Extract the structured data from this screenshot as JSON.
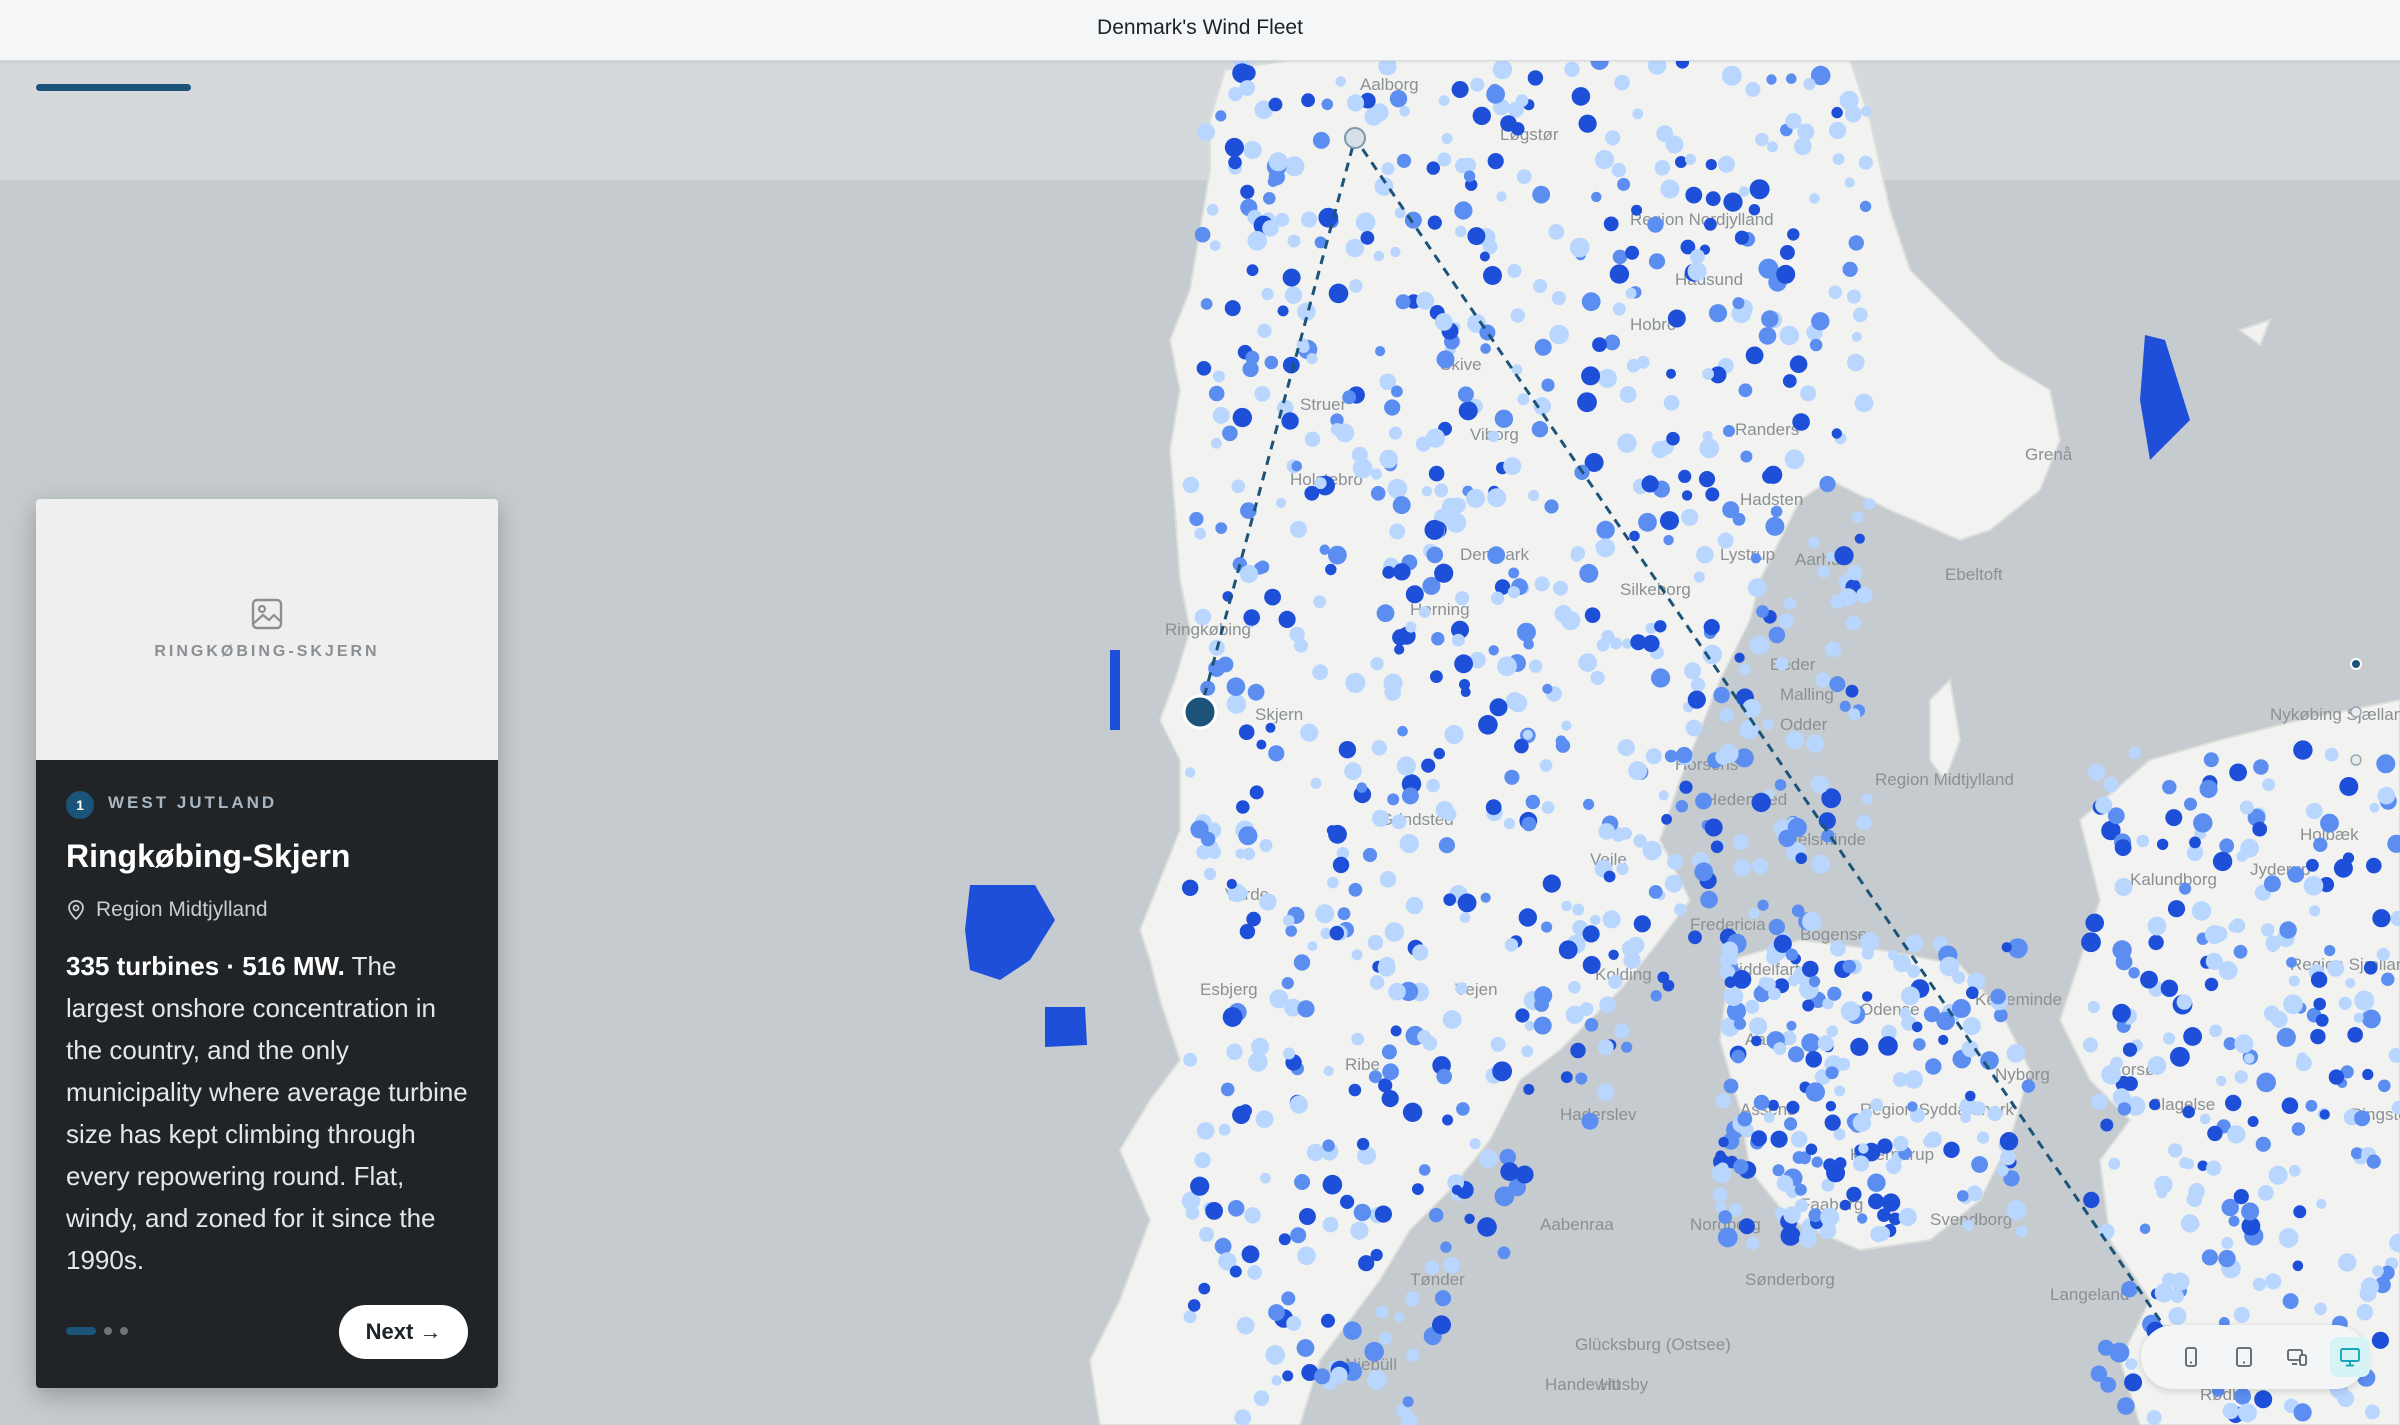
{
  "header": {
    "title": "Denmark's Wind Fleet"
  },
  "colors": {
    "accent": "#1b5478",
    "turbine_large": "#1e4fd8",
    "turbine_medium": "#5b8ef0",
    "turbine_small": "#b9d6ff",
    "land": "#f2f3f1",
    "water": "#c5cbce",
    "card_dark": "#202427",
    "route_line": "#1b5478"
  },
  "map": {
    "place_labels": [
      "Aalborg",
      "Løgstør",
      "Region Nordjylland",
      "Hobro",
      "Hadsund",
      "Randers",
      "Grenå",
      "Struer",
      "Holstebro",
      "Viborg",
      "Hadsten",
      "Lystrup",
      "Ebeltoft",
      "Skive",
      "Denmark",
      "Silkeborg",
      "Aarhus",
      "Herning",
      "Ringkøbing",
      "Skjern",
      "Beder",
      "Malling",
      "Odder",
      "Horsens",
      "Hedensted",
      "Juelsminde",
      "Region Midtjylland",
      "Grindsted",
      "Vejle",
      "Varde",
      "Fredericia",
      "Bogense",
      "Kerteminde",
      "Esbjerg",
      "Kolding",
      "Middelfart",
      "Odense",
      "Nyborg",
      "Korsør",
      "Ribe",
      "Vejen",
      "Aarup",
      "Assens",
      "Region Syddanmark",
      "Haderslev",
      "Kværndrup",
      "Faaborg",
      "Svendborg",
      "Nykøbing Sjælland",
      "Holbæk",
      "Kalundborg",
      "Jyderup",
      "Region Sjælland",
      "Slagelse",
      "Ringsted",
      "Aabenraa",
      "Nordborg",
      "Sønderborg",
      "Tønder",
      "Niebüll",
      "Glücksburg (Ostsee)",
      "Handewitt",
      "Husby",
      "Langeland",
      "Rødby"
    ]
  },
  "story_card": {
    "image_placeholder_label": "RINGKØBING-SKJERN",
    "step_number": "1",
    "kicker": "WEST JUTLAND",
    "title": "Ringkøbing-Skjern",
    "region": "Region Midtjylland",
    "stats": "335 turbines · 516 MW.",
    "description": " The largest onshore concentration in the country, and the only municipality where average turbine size has kept climbing through every repowering round. Flat, windy, and zoned for it since the 1990s.",
    "current_step": 1,
    "total_steps": 3,
    "next_label": "Next",
    "next_arrow": "→"
  },
  "device_toolbar": {
    "items": [
      {
        "name": "mobile-icon",
        "active": false
      },
      {
        "name": "tablet-icon",
        "active": false
      },
      {
        "name": "responsive-icon",
        "active": false
      },
      {
        "name": "desktop-icon",
        "active": true
      }
    ]
  }
}
